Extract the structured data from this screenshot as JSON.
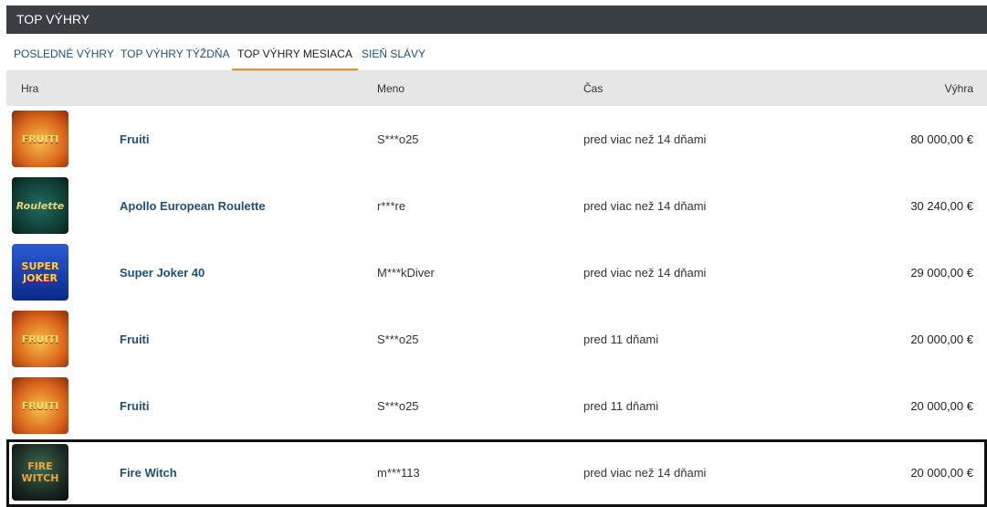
{
  "header": {
    "title": "TOP VÝHRY"
  },
  "tabs": [
    {
      "label": "POSLEDNÉ VÝHRY",
      "active": false
    },
    {
      "label": "TOP VÝHRY TÝŽDŇA",
      "active": false
    },
    {
      "label": "TOP VÝHRY MESIACA",
      "active": true
    },
    {
      "label": "SIEŇ SLÁVY",
      "active": false
    }
  ],
  "table": {
    "columns": {
      "game": "Hra",
      "name": "Meno",
      "time": "Čas",
      "win": "Výhra"
    },
    "rows": [
      {
        "thumb_text": "FRUITI",
        "thumb_icon": "fruiti-game-icon",
        "game": "Fruiti",
        "name": "S***o25",
        "time": "pred viac než 14 dňami",
        "win": "80 000,00 €"
      },
      {
        "thumb_text": "Roulette",
        "thumb_icon": "roulette-game-icon",
        "game": "Apollo European Roulette",
        "name": "r***re",
        "time": "pred viac než 14 dňami",
        "win": "30 240,00 €"
      },
      {
        "thumb_text": "SUPER JOKER",
        "thumb_icon": "super-joker-game-icon",
        "game": "Super Joker 40",
        "name": "M***kDiver",
        "time": "pred viac než 14 dňami",
        "win": "29 000,00 €"
      },
      {
        "thumb_text": "FRUITI",
        "thumb_icon": "fruiti-game-icon",
        "game": "Fruiti",
        "name": "S***o25",
        "time": "pred 11 dňami",
        "win": "20 000,00 €"
      },
      {
        "thumb_text": "FRUITI",
        "thumb_icon": "fruiti-game-icon",
        "game": "Fruiti",
        "name": "S***o25",
        "time": "pred 11 dňami",
        "win": "20 000,00 €"
      },
      {
        "thumb_text": "FIRE WITCH",
        "thumb_icon": "fire-witch-game-icon",
        "game": "Fire Witch",
        "name": "m***113",
        "time": "pred viac než 14 dňami",
        "win": "20 000,00 €"
      }
    ]
  },
  "colors": {
    "header_bg": "#3a3f44",
    "link": "#1e4f7a",
    "active_tab_underline": "#f08a24"
  }
}
